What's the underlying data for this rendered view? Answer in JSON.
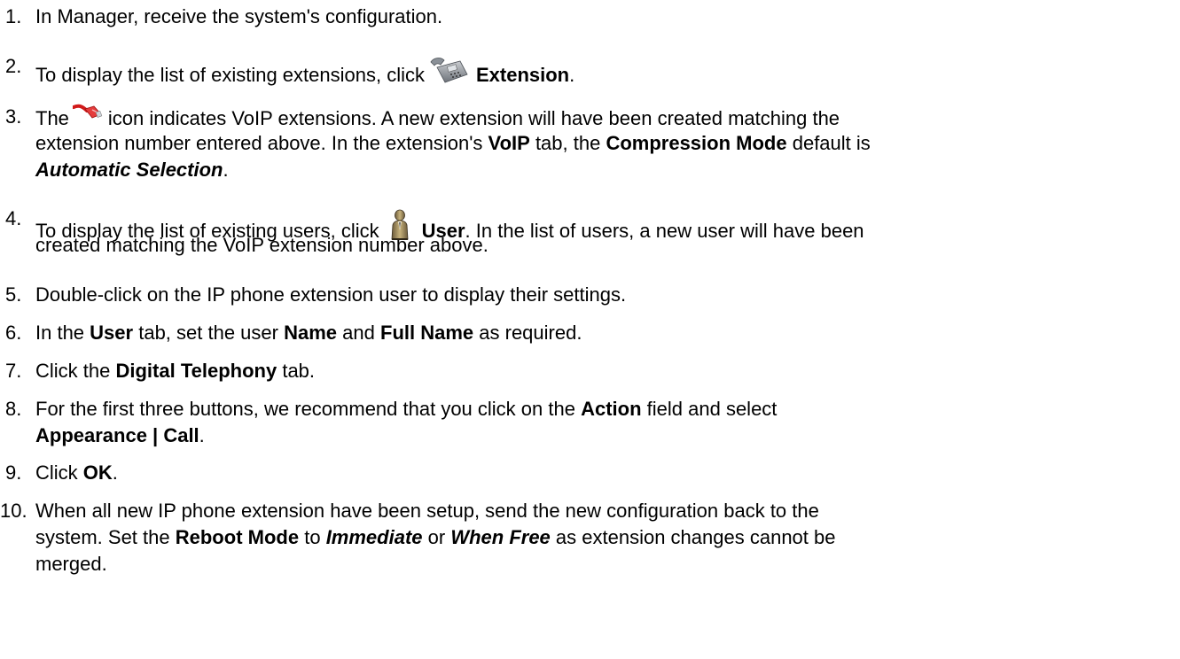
{
  "steps": [
    {
      "number": "1.",
      "text": "In Manager, receive the system's configuration."
    },
    {
      "number": "2.",
      "text_before": "To display the list of existing extensions, click",
      "icon": "desk-phone-icon",
      "bold": "Extension",
      "text_after": "."
    },
    {
      "number": "3.",
      "line1_before": "The",
      "icon": "network-cable-icon",
      "line1_after": "icon indicates VoIP extensions. A new extension will have been created matching the",
      "line2_a": "extension number entered above. In the extension's",
      "line2_bold1": "VoIP",
      "line2_b": "tab, the",
      "line2_bold2": "Compression Mode",
      "line2_c": "default is",
      "line3_bold_italic": "Automatic Selection",
      "line3_after": "."
    },
    {
      "number": "4.",
      "line1_before": "To display the list of existing users, click",
      "icon": "user-icon",
      "line1_bold": "User",
      "line1_after": ". In the list of users, a new user will have been",
      "line2": "created matching the VoIP extension number above."
    },
    {
      "number": "5.",
      "text": "Double-click on the IP phone extension user to display their settings."
    },
    {
      "number": "6.",
      "text_a": "In the",
      "bold1": "User",
      "text_b": "tab, set the user",
      "bold2": "Name",
      "text_c": "and",
      "bold3": "Full Name",
      "text_d": "as required."
    },
    {
      "number": "7.",
      "text_a": "Click the",
      "bold": "Digital Telephony",
      "text_b": "tab."
    },
    {
      "number": "8.",
      "line1_a": "For the first three buttons, we recommend that you click on the",
      "line1_bold": "Action",
      "line1_b": "field and select",
      "line2_bold": "Appearance | Call",
      "line2_after": "."
    },
    {
      "number": "9.",
      "text_a": "Click",
      "bold": "OK",
      "text_b": "."
    },
    {
      "number": "10.",
      "line1": "When all new IP phone extension have been setup, send the new configuration back to the",
      "line2_a": "system. Set the",
      "line2_bold": "Reboot Mode",
      "line2_b": "to",
      "line2_bi1": "Immediate",
      "line2_c": "or",
      "line2_bi2": "When Free",
      "line2_d": "as extension changes cannot be",
      "line3": "merged."
    }
  ]
}
